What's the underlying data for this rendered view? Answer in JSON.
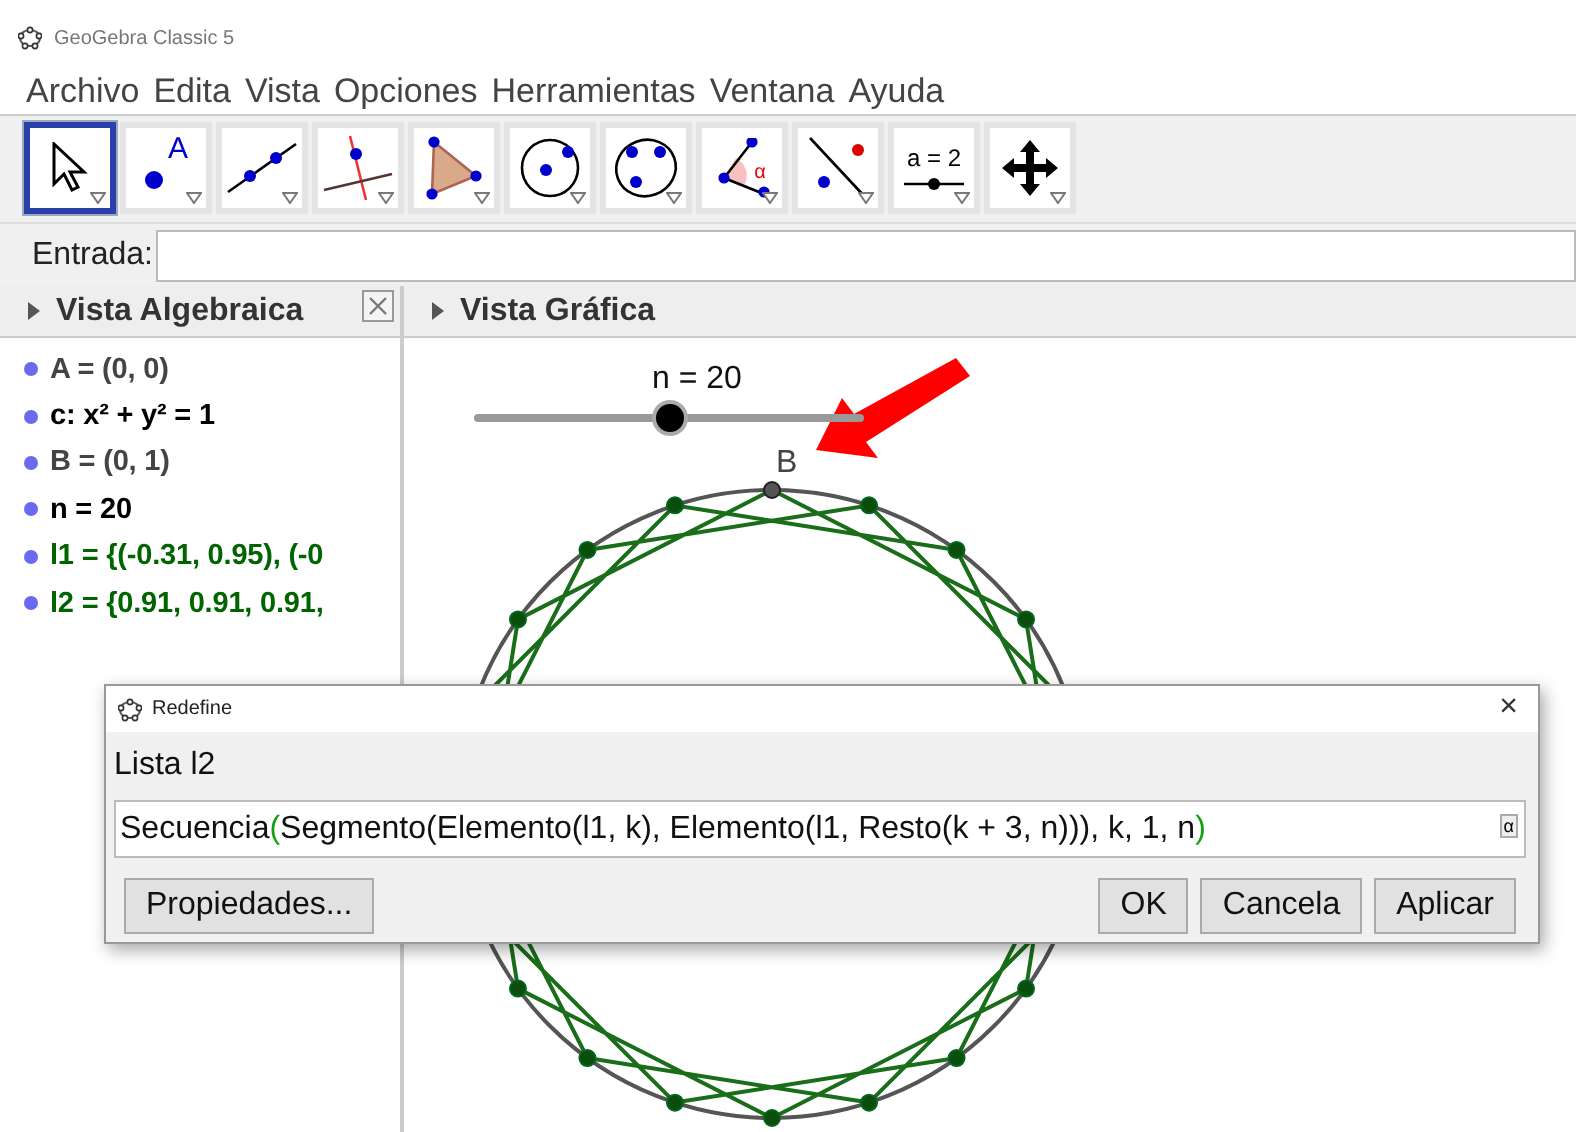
{
  "window": {
    "title": "GeoGebra Classic 5"
  },
  "menu": [
    "Archivo",
    "Edita",
    "Vista",
    "Opciones",
    "Herramientas",
    "Ventana",
    "Ayuda"
  ],
  "toolbar": [
    {
      "kind": "move",
      "selected": true
    },
    {
      "kind": "point",
      "selected": false,
      "label": "A"
    },
    {
      "kind": "line",
      "selected": false
    },
    {
      "kind": "perpendicular",
      "selected": false
    },
    {
      "kind": "polygon",
      "selected": false
    },
    {
      "kind": "circle",
      "selected": false
    },
    {
      "kind": "conic",
      "selected": false
    },
    {
      "kind": "angle",
      "selected": false,
      "label": "α"
    },
    {
      "kind": "reflect",
      "selected": false
    },
    {
      "kind": "slider",
      "selected": false,
      "label": "a = 2"
    },
    {
      "kind": "move-view",
      "selected": false
    }
  ],
  "input_bar": {
    "label": "Entrada:"
  },
  "algebra_view": {
    "title": "Vista Algebraica",
    "items": [
      {
        "text": "A = (0, 0)",
        "color": "#444444"
      },
      {
        "text": "c: x² + y² = 1",
        "color": "#000000"
      },
      {
        "text": "B = (0, 1)",
        "color": "#444444"
      },
      {
        "text": "n = 20",
        "color": "#000000"
      },
      {
        "text": "l1 = {(-0.31, 0.95), (-0",
        "color": "#006400"
      },
      {
        "text": "l2 = {0.91, 0.91, 0.91,",
        "color": "#006400"
      }
    ]
  },
  "graphics_view": {
    "title": "Vista Gráfica",
    "slider": {
      "label": "n = 20",
      "level": 0.5
    },
    "point_label": "B"
  },
  "dialog": {
    "title": "Redefine",
    "close": "×",
    "heading": "Lista l2",
    "value_parts": [
      {
        "text": "Secuencia",
        "matched": false
      },
      {
        "text": "(",
        "matched": true
      },
      {
        "text": "Segmento(Elemento(l1, k), Elemento(l1, Resto(k + 3, n))), k, 1, n",
        "matched": false
      },
      {
        "text": ")",
        "matched": true
      }
    ],
    "symbol_button": "α",
    "buttons": [
      {
        "label": "Propiedades...",
        "kind": "left"
      },
      {
        "label": "OK",
        "kind": "right"
      },
      {
        "label": "Cancela",
        "kind": "right"
      },
      {
        "label": "Aplicar",
        "kind": "right"
      }
    ]
  }
}
